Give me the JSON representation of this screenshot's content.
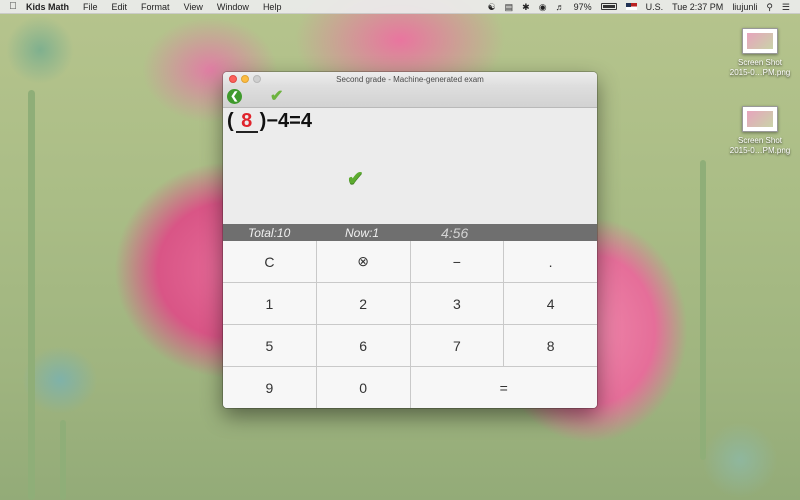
{
  "menubar": {
    "app_name": "Kids Math",
    "menus": [
      "File",
      "Edit",
      "Format",
      "View",
      "Window",
      "Help"
    ],
    "battery_percent": "97%",
    "input_source": "U.S.",
    "clock": "Tue 2:37 PM",
    "user": "liujunli"
  },
  "desktop": {
    "icons": [
      {
        "label_line1": "Screen Shot",
        "label_line2": "2015-0…PM.png"
      },
      {
        "label_line1": "Screen Shot",
        "label_line2": "2015-0…PM.png"
      }
    ]
  },
  "window": {
    "title": "Second grade - Machine-generated exam",
    "equation": {
      "open_paren": "(",
      "answer": "8",
      "rest": ")−4=4"
    },
    "status": {
      "total": "Total:10",
      "now": "Now:1",
      "timer": "4:56"
    },
    "keypad": [
      "C",
      "⊗",
      "−",
      ".",
      "1",
      "2",
      "3",
      "4",
      "5",
      "6",
      "7",
      "8",
      "9",
      "0",
      "="
    ]
  },
  "colors": {
    "answer_red": "#e0242c",
    "check_green": "#5cab2f",
    "statusbar_gray": "#6f6f6f"
  }
}
